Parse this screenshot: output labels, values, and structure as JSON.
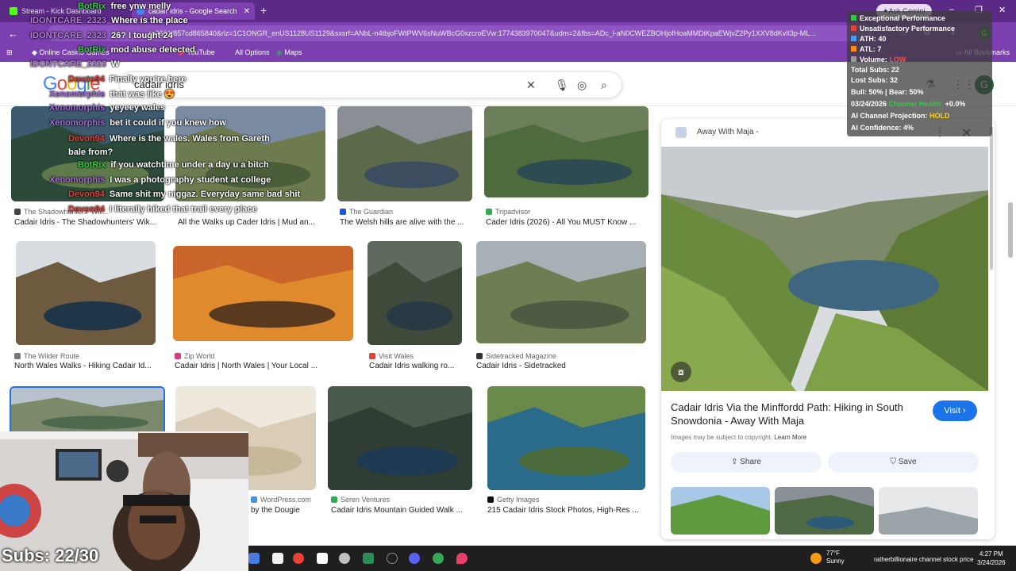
{
  "tabs": [
    {
      "title": "Stream - Kick Dashboard",
      "favicon_color": "#53fc18"
    },
    {
      "title": "cadair idris - Google Search",
      "favicon_color": "#4285f4"
    }
  ],
  "ask_gemini": "Ask Gemini",
  "address_url": "...r=3631f857cd865840&rlz=1C1ONGR_enUS1128US1129&sxsrf=ANbL-n4tbjoFWtPWV6sNuWBcG0xzcroEVw:1774383970047&udm=2&fbs=ADc_l-aN0CWEZBOHjofHoaMMDiKpaEWjvZ2Py1XXV8dKvIl3p-ML...",
  "bookmarks": [
    {
      "label": "Online Casino Games",
      "icon": "casino-icon"
    },
    {
      "label": "YouTube",
      "icon": "youtube-icon"
    },
    {
      "label": "All Options",
      "icon": ""
    },
    {
      "label": "Maps",
      "icon": "maps-icon"
    }
  ],
  "all_bookmarks": "All Bookmarks",
  "search": {
    "query": "cadair idris"
  },
  "google_logo": [
    "G",
    "o",
    "o",
    "g",
    "l",
    "e"
  ],
  "avatar_letter": "G",
  "results": [
    {
      "source": "The Shadowhunters' Wik...",
      "caption": "Cadair Idris - The Shadowhunters' Wik...",
      "colors": [
        "#3e5a6e",
        "#2b4a3a",
        "#5f7a4a"
      ]
    },
    {
      "source": "",
      "caption": "All the Walks up Cader Idris | Mud an...",
      "colors": [
        "#7a8aa0",
        "#6e7b4e",
        "#4a5e3a"
      ]
    },
    {
      "source": "The Guardian",
      "caption": "The Welsh hills are alive with the ...",
      "colors": [
        "#8a8f95",
        "#5a6a4a",
        "#3b4d5e"
      ]
    },
    {
      "source": "Tripadvisor",
      "caption": "Cader Idris (2026) - All You MUST Know ...",
      "colors": [
        "#6b7f5a",
        "#4d6b3d",
        "#2e4a52"
      ]
    },
    {
      "source": "The Wilder Route",
      "caption": "North Wales Walks - Hiking Cadair Id...",
      "colors": [
        "#d8dde2",
        "#6e5a3e",
        "#1f3548"
      ]
    },
    {
      "source": "Zip World",
      "caption": "Cadair Idris | North Wales | Your Local ...",
      "colors": [
        "#c9652a",
        "#e08a2e",
        "#5a3a1e"
      ]
    },
    {
      "source": "Visit Wales",
      "caption": "Cadair Idris walking ro...",
      "colors": [
        "#5e6a5e",
        "#3e4a3a",
        "#2a3a45"
      ]
    },
    {
      "source": "Sidetracked Magazine",
      "caption": "Cadair Idris - Sidetracked",
      "colors": [
        "#a8b0b5",
        "#6e7e52",
        "#4e5a42"
      ]
    },
    {
      "source": "",
      "caption": "",
      "colors": [
        "#b8c2cc",
        "#7a8a6a",
        "#4e6a4e"
      ]
    },
    {
      "source": "WordPress.com",
      "caption": "by the Dougie",
      "colors": [
        "#efe8dc",
        "#d9cdb8",
        "#c8b89a"
      ]
    },
    {
      "source": "Seren Ventures",
      "caption": "Cadair Idris Mountain Guided Walk ...",
      "colors": [
        "#4a5a4a",
        "#2e3e35",
        "#1e3a52"
      ]
    },
    {
      "source": "Getty Images",
      "caption": "215 Cadair Idris Stock Photos, High-Res ...",
      "colors": [
        "#6a8a4a",
        "#2a6a8a",
        "#4a6a3a"
      ]
    }
  ],
  "panel": {
    "source": "Away With Maja -",
    "title": "Cadair Idris Via the Minffordd Path: Hiking in South Snowdonia - Away With Maja",
    "visit": "Visit",
    "copyright": "Images may be subject to copyright.",
    "learn_more": "Learn More",
    "share": "Share",
    "save": "Save"
  },
  "chat": [
    {
      "user": "BotRix",
      "msg": "free ynw melly",
      "color": "#2ecc40"
    },
    {
      "user": "IDONTCARE_2323",
      "msg": "Where is the place",
      "color": "#b57edc"
    },
    {
      "user": "IDONTCARE_2323",
      "msg": "26? I tought 24",
      "color": "#b57edc"
    },
    {
      "user": "BotRix",
      "msg": "mod abuse detected",
      "color": "#2ecc40"
    },
    {
      "user": "IDONTCARE_2323",
      "msg": "W",
      "color": "#b57edc"
    },
    {
      "user": "Devon94",
      "msg": "Finally you're here",
      "color": "#e0443c"
    },
    {
      "user": "Xenomorphis",
      "msg": "that was like 😍",
      "color": "#a36bd6"
    },
    {
      "user": "Xenomorphis",
      "msg": "yeyeey wales",
      "color": "#a36bd6"
    },
    {
      "user": "Xenomorphis",
      "msg": "bet it could if you knew how",
      "color": "#a36bd6"
    },
    {
      "user": "Devon94",
      "msg": "Where is the wales. Wales from Gareth bale from?",
      "color": "#e0443c"
    },
    {
      "user": "BotRix",
      "msg": "if you watchtime under a day u a bitch",
      "color": "#2ecc40"
    },
    {
      "user": "Xenomorphis",
      "msg": "I was a photography student at college",
      "color": "#a36bd6"
    },
    {
      "user": "Devon94",
      "msg": "Same shit my niggaz. Everyday same bad shit",
      "color": "#e0443c"
    },
    {
      "user": "Devon94",
      "msg": "I literally hiked that trail every place",
      "color": "#e0443c"
    }
  ],
  "stats": {
    "exceptional": "Exceptional Performance",
    "unsatisfactory": "Unsatisfactory Performance",
    "ath": "ATH: 40",
    "atl": "ATL: 7",
    "volume_label": "Volume:",
    "volume_value": "LOW",
    "total_subs": "Total Subs: 22",
    "lost_subs": "Lost Subs: 32",
    "bull_bear": "Bull: 50% | Bear: 50%",
    "date": "03/24/2026",
    "health_label": "Channel Health:",
    "health_value": "+0.0%",
    "projection_label": "AI Channel Projection:",
    "projection_value": "HOLD",
    "confidence": "AI Confidence: 4%"
  },
  "subs_counter": "Subs: 22/30",
  "taskbar": {
    "temp": "77°F",
    "condition": "Sunny",
    "ticker": "ratherbillionaire channel stock price",
    "time": "4:27 PM",
    "date": "3/24/2026"
  }
}
